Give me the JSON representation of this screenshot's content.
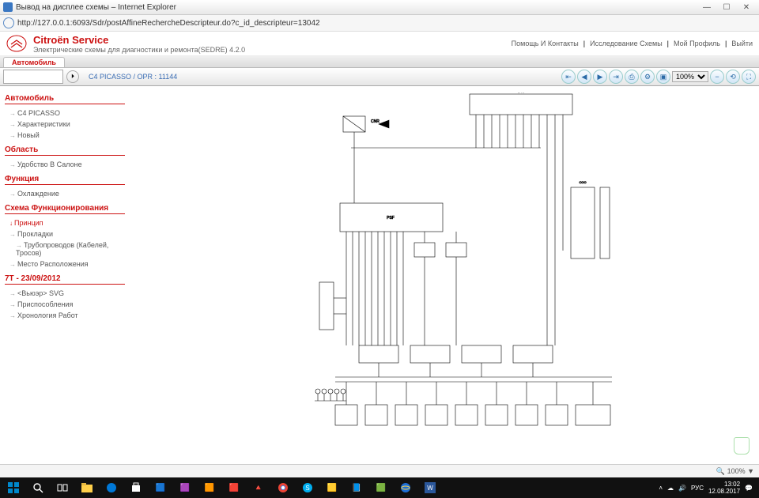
{
  "window": {
    "title": "Вывод на дисплее схемы – Internet Explorer",
    "url": "http://127.0.0.1:6093/Sdr/postAffineRechercheDescripteur.do?c_id_descripteur=13042"
  },
  "brand": {
    "title": "Citroën Service",
    "sub": "Электрические схемы для диагностики и ремонта(SEDRE) 4.2.0"
  },
  "topnav": [
    "Помощь И Контакты",
    "Исследование Схемы",
    "Мой Профиль",
    "Выйти"
  ],
  "tab": "Автомобиль",
  "breadcrumb": "C4 PICASSO  /  OPR : 11144",
  "zoom_select": "100%",
  "sidebar": {
    "s1": {
      "head": "Автомобиль",
      "items": [
        "C4 PICASSO",
        "Характеристики",
        "Новый"
      ]
    },
    "s2": {
      "head": "Область",
      "items": [
        "Удобство В Салоне"
      ]
    },
    "s3": {
      "head": "Функция",
      "items": [
        "Охлаждение"
      ]
    },
    "s4": {
      "head": "Схема Функционирования",
      "items": [
        "Принцип",
        "Прокладки",
        "Трубопроводов (Кабелей, Тросов)",
        "Место Расположения"
      ],
      "active": 0
    },
    "s5": {
      "head": "7T - 23/09/2012",
      "items": [
        "<Вьюэр> SVG",
        "Приспособления",
        "Хронология Работ"
      ]
    }
  },
  "status": {
    "zoom": "🔍 100%  ▼"
  },
  "tray": {
    "lang": "РУС",
    "time": "13:02",
    "date": "12.08.2017"
  },
  "diagram_labels": {
    "top": "BVI",
    "l1": "CNR",
    "psf": "PSF",
    "coo": "COO"
  }
}
